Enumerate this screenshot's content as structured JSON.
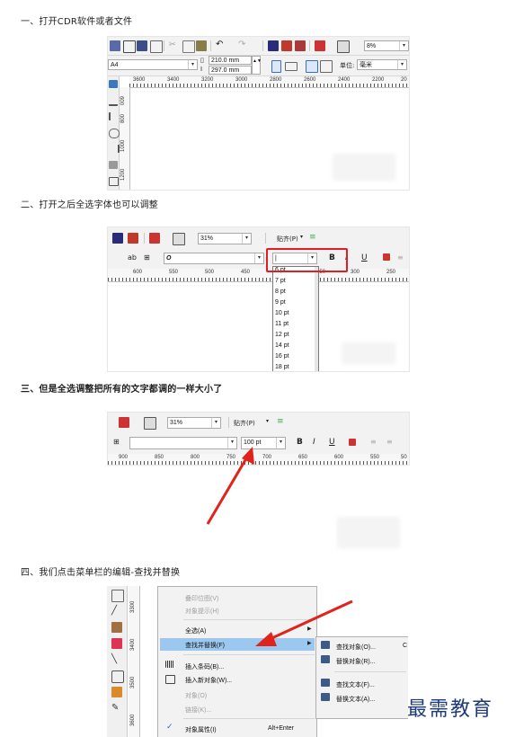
{
  "steps": {
    "s1": "一、打开CDR软件或者文件",
    "s2": "二、打开之后全选字体也可以调整",
    "s3": "三、但是全选调整把所有的文字都调的一样大小了",
    "s4": "四、我们点击菜单栏的编辑-查找并替换"
  },
  "shot1": {
    "zoom": "8%",
    "page_size": "A4",
    "width": "210.0 mm",
    "height": "297.0 mm",
    "unit_label": "单位:",
    "unit_value": "毫米",
    "ruler_labels": [
      "3600",
      "3400",
      "3200",
      "3000",
      "2800",
      "2600",
      "2400",
      "2200",
      "20"
    ],
    "vruler_labels": [
      "009",
      "800",
      "1000",
      "1200"
    ]
  },
  "shot2": {
    "zoom": "31%",
    "snap_label": "贴齐(P)",
    "font_style_glyph": "O",
    "size_value": "|",
    "ruler_labels": [
      "600",
      "550",
      "500",
      "450",
      "400",
      "350",
      "300",
      "250"
    ],
    "size_options": [
      "6 pt",
      "7 pt",
      "8 pt",
      "9 pt",
      "10 pt",
      "11 pt",
      "12 pt",
      "14 pt",
      "16 pt",
      "18 pt"
    ]
  },
  "shot3": {
    "zoom": "31%",
    "snap_label": "贴齐(P)",
    "size_value": "100 pt",
    "ruler_labels": [
      "900",
      "850",
      "800",
      "750",
      "700",
      "650",
      "600",
      "550",
      "50"
    ]
  },
  "shot4": {
    "vruler_labels": [
      "3300",
      "3400",
      "3500",
      "3600"
    ],
    "menu_items": [
      {
        "label": "叠印位图(V)",
        "disabled": true
      },
      {
        "label": "对象提示(H)",
        "disabled": true
      },
      {
        "label": "全选(A)",
        "disabled": false,
        "submenu": true
      },
      {
        "label": "查找并替换(F)",
        "disabled": false,
        "submenu": true,
        "highlighted": true
      },
      {
        "label": "插入条码(B)...",
        "disabled": false
      },
      {
        "label": "插入新对象(W)...",
        "disabled": false
      },
      {
        "label": "对象(O)",
        "disabled": true
      },
      {
        "label": "链接(K)...",
        "disabled": true
      },
      {
        "label": "对象属性(I)",
        "disabled": false,
        "checked": true,
        "shortcut": "Alt+Enter"
      }
    ],
    "submenu_items": [
      {
        "label": "查找对象(O)...",
        "extra": "C"
      },
      {
        "label": "替换对象(R)..."
      },
      {
        "label": "查找文本(F)..."
      },
      {
        "label": "替换文本(A)..."
      }
    ]
  },
  "watermark": "最需教育",
  "colors": {
    "highlight_box": "#e02020",
    "menu_highlight": "#9cc8ef",
    "arrow": "#e0241b",
    "toolbar_bg": "#f2f2f2"
  }
}
